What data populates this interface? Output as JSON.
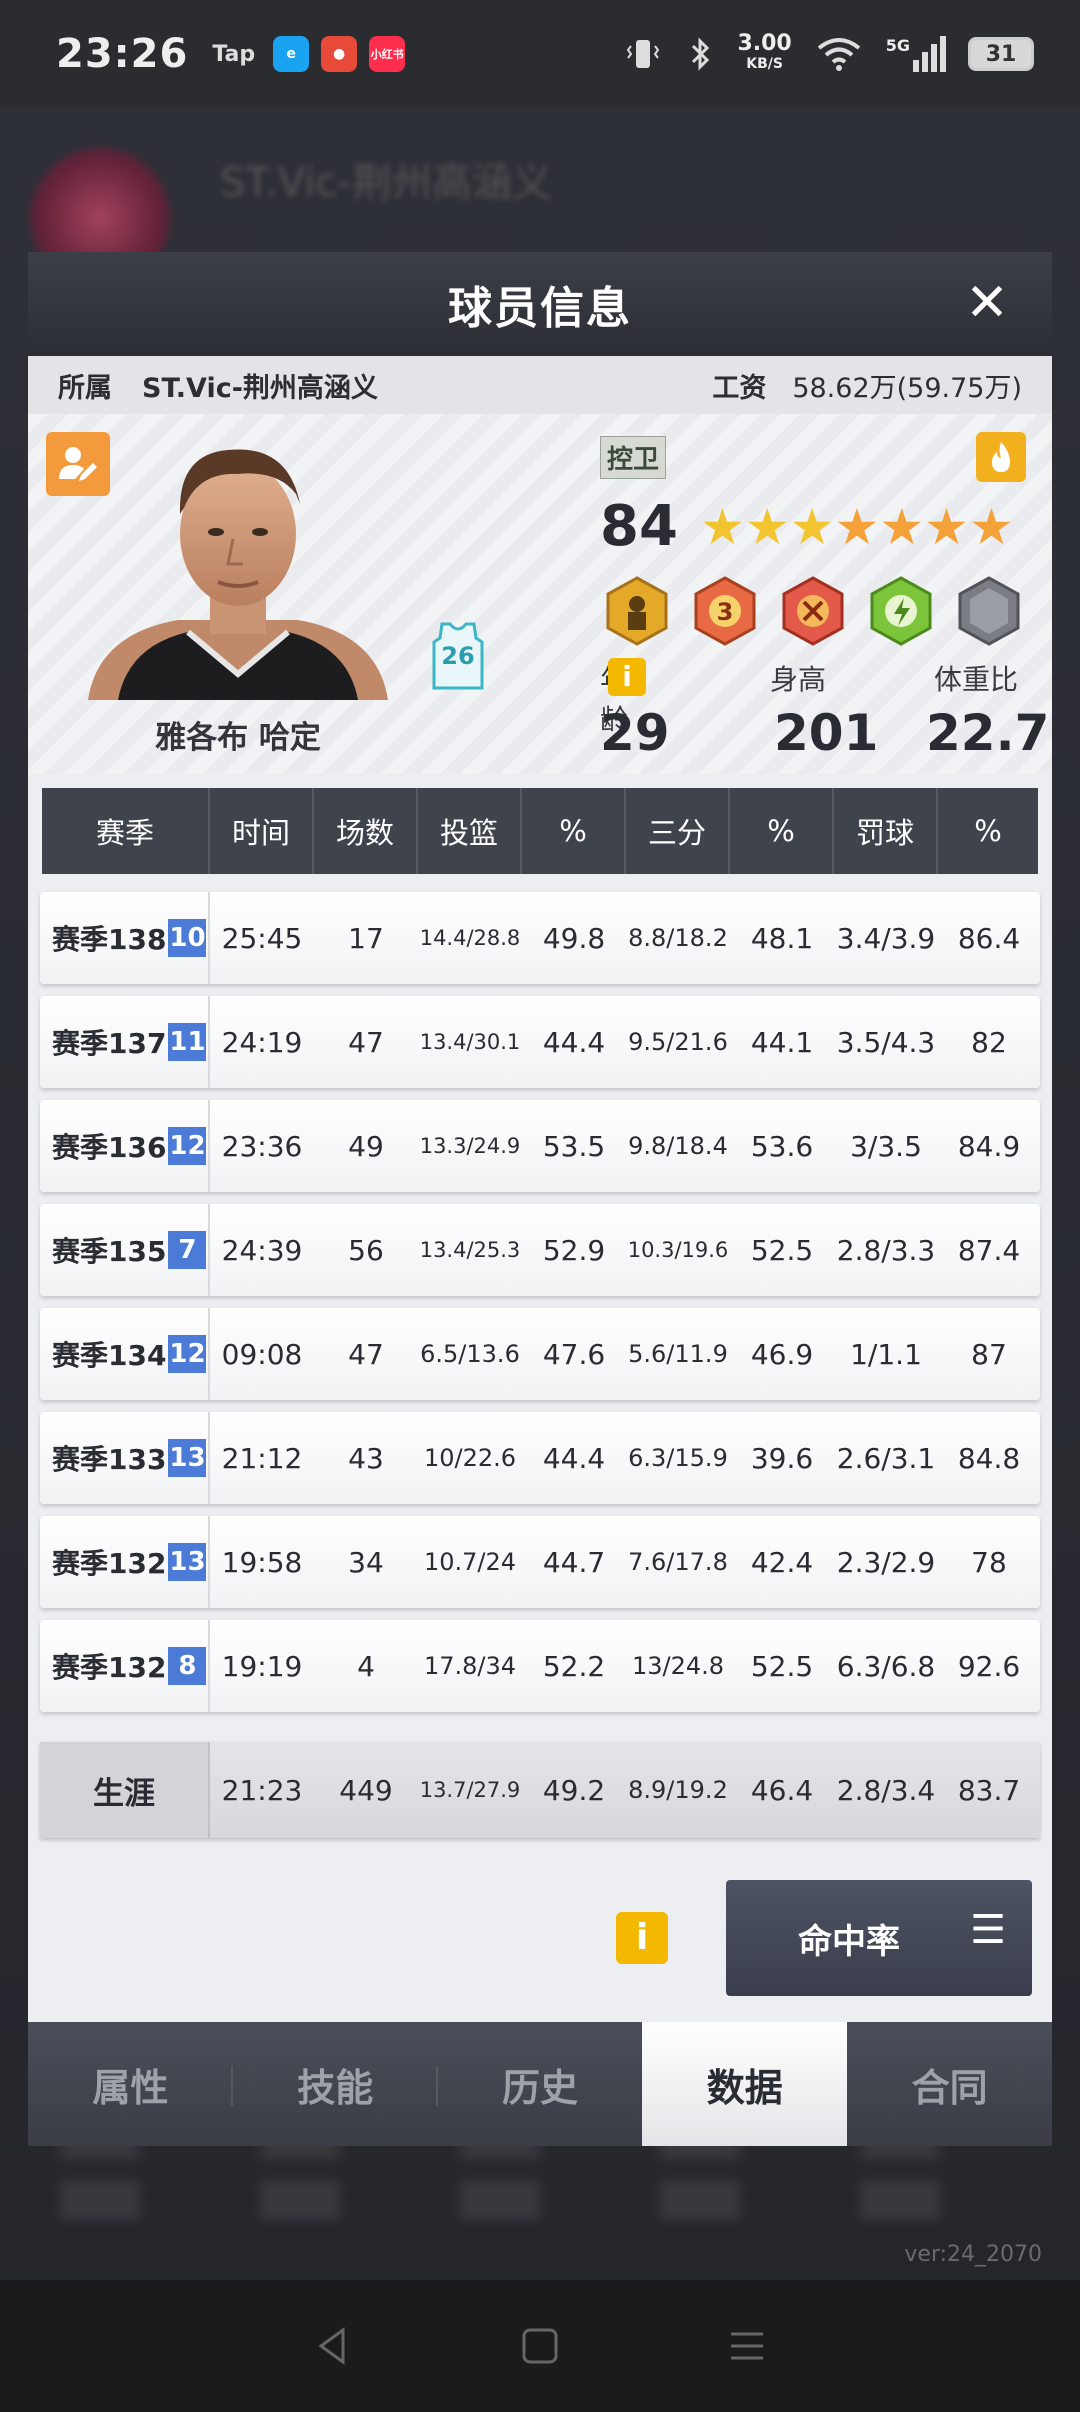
{
  "status_bar": {
    "time": "23:26",
    "tap_label": "Tap",
    "app_icon_3": "小红书",
    "net_speed": "3.00",
    "net_unit": "KB/S",
    "network": "5G",
    "battery": "31"
  },
  "background": {
    "team_text": "ST.Vic-荆州高涵义",
    "version": "ver:24_2070"
  },
  "dialog": {
    "title": "球员信息",
    "close": "✕",
    "team_label": "所属",
    "team_name": "ST.Vic-荆州高涵义",
    "salary_label": "工资",
    "salary_value": "58.62万(59.75万)",
    "player": {
      "name": "雅各布 哈定",
      "jersey_number": "26",
      "position": "控卫",
      "overall": "84",
      "stars": 7,
      "age_label": "年龄",
      "height_label": "身高",
      "ratio_label": "体重比",
      "age": "29",
      "height": "201",
      "ratio": "22.7",
      "info_icon": "i"
    },
    "table": {
      "headers": [
        "赛季",
        "时间",
        "场数",
        "投篮",
        "%",
        "三分",
        "%",
        "罚球",
        "%"
      ],
      "rows": [
        {
          "season": "赛季138",
          "num": "10",
          "time": "25:45",
          "games": "17",
          "fg": "14.4/28.8",
          "fg_pct": "49.8",
          "three": "8.8/18.2",
          "three_pct": "48.1",
          "ft": "3.4/3.9",
          "ft_pct": "86.4"
        },
        {
          "season": "赛季137",
          "num": "11",
          "time": "24:19",
          "games": "47",
          "fg": "13.4/30.1",
          "fg_pct": "44.4",
          "three": "9.5/21.6",
          "three_pct": "44.1",
          "ft": "3.5/4.3",
          "ft_pct": "82"
        },
        {
          "season": "赛季136",
          "num": "12",
          "time": "23:36",
          "games": "49",
          "fg": "13.3/24.9",
          "fg_pct": "53.5",
          "three": "9.8/18.4",
          "three_pct": "53.6",
          "ft": "3/3.5",
          "ft_pct": "84.9"
        },
        {
          "season": "赛季135",
          "num": "7",
          "time": "24:39",
          "games": "56",
          "fg": "13.4/25.3",
          "fg_pct": "52.9",
          "three": "10.3/19.6",
          "three_pct": "52.5",
          "ft": "2.8/3.3",
          "ft_pct": "87.4"
        },
        {
          "season": "赛季134",
          "num": "12",
          "time": "09:08",
          "games": "47",
          "fg": "6.5/13.6",
          "fg_pct": "47.6",
          "three": "5.6/11.9",
          "three_pct": "46.9",
          "ft": "1/1.1",
          "ft_pct": "87"
        },
        {
          "season": "赛季133",
          "num": "13",
          "time": "21:12",
          "games": "43",
          "fg": "10/22.6",
          "fg_pct": "44.4",
          "three": "6.3/15.9",
          "three_pct": "39.6",
          "ft": "2.6/3.1",
          "ft_pct": "84.8"
        },
        {
          "season": "赛季132",
          "num": "13",
          "time": "19:58",
          "games": "34",
          "fg": "10.7/24",
          "fg_pct": "44.7",
          "three": "7.6/17.8",
          "three_pct": "42.4",
          "ft": "2.3/2.9",
          "ft_pct": "78"
        },
        {
          "season": "赛季132",
          "num": "8",
          "time": "19:19",
          "games": "4",
          "fg": "17.8/34",
          "fg_pct": "52.2",
          "three": "13/24.8",
          "three_pct": "52.5",
          "ft": "6.3/6.8",
          "ft_pct": "92.6"
        }
      ],
      "career": {
        "label": "生涯",
        "time": "21:23",
        "games": "449",
        "fg": "13.7/27.9",
        "fg_pct": "49.2",
        "three": "8.9/19.2",
        "three_pct": "46.4",
        "ft": "2.8/3.4",
        "ft_pct": "83.7"
      }
    },
    "footer": {
      "info_icon": "i",
      "hit_rate_button": "命中率",
      "menu_icon": "☰"
    },
    "tabs": [
      "属性",
      "技能",
      "历史",
      "数据",
      "合同"
    ],
    "active_tab": 3
  },
  "colors": {
    "header_dark": "#3f434b",
    "season_badge": "#4b7bd6",
    "accent_yellow": "#f5b800",
    "edit_orange": "#f39a3c"
  }
}
